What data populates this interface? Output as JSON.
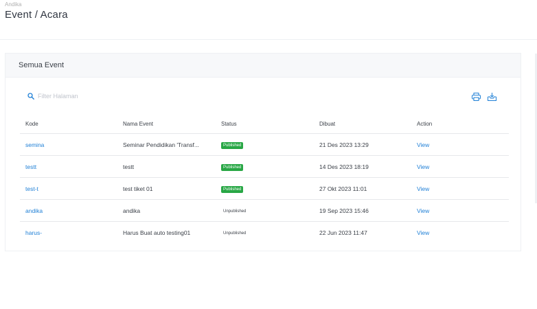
{
  "header": {
    "breadcrumb": "Andika",
    "title": "Event / Acara"
  },
  "card": {
    "title": "Semua Event"
  },
  "search": {
    "placeholder": "Filter Halaman",
    "icon": "search-icon"
  },
  "tools": [
    {
      "icon": "print-icon"
    },
    {
      "icon": "export-icon"
    }
  ],
  "colors": {
    "accent": "#1e7fd6",
    "published": "#28a745"
  },
  "table": {
    "headers": [
      "Kode",
      "Nama Event",
      "Status",
      "Dibuat",
      "Action"
    ],
    "rows": [
      {
        "code": "semina",
        "name": "Seminar Pendidikan 'Transf...",
        "status": "Published",
        "published": true,
        "created": "21 Des 2023 13:29",
        "action": "View"
      },
      {
        "code": "testt",
        "name": "testt",
        "status": "Published",
        "published": true,
        "created": "14 Des 2023 18:19",
        "action": "View"
      },
      {
        "code": "test-t",
        "name": "test tiket 01",
        "status": "Published",
        "published": true,
        "created": "27 Okt 2023 11:01",
        "action": "View"
      },
      {
        "code": "andika",
        "name": "andika",
        "status": "Unpublished",
        "published": false,
        "created": "19 Sep 2023 15:46",
        "action": "View"
      },
      {
        "code": "harus-",
        "name": "Harus Buat auto testing01",
        "status": "Unpublished",
        "published": false,
        "created": "22 Jun 2023 11:47",
        "action": "View"
      }
    ]
  }
}
